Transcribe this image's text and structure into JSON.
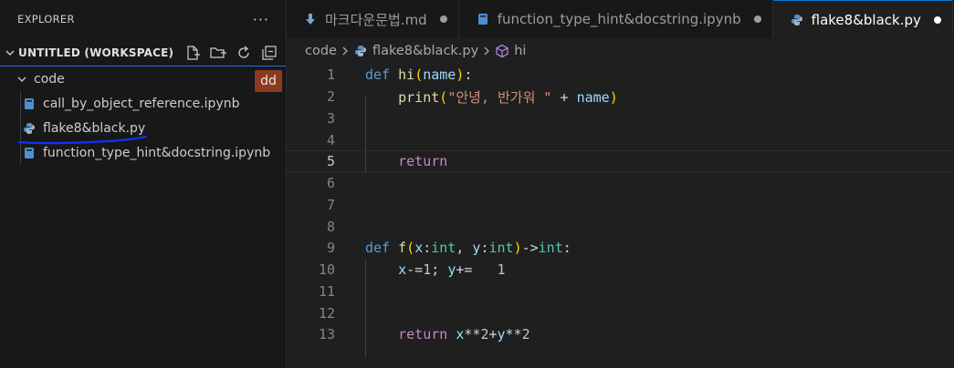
{
  "sidebar": {
    "title": "EXPLORER",
    "more": "···",
    "workspace": "UNTITLED (WORKSPACE)",
    "folder": "code",
    "badge": "dd",
    "files": [
      {
        "name": "call_by_object_reference.ipynb",
        "icon": "notebook-icon"
      },
      {
        "name": "flake8&black.py",
        "icon": "python-icon"
      },
      {
        "name": "function_type_hint&docstring.ipynb",
        "icon": "notebook-icon"
      }
    ]
  },
  "tabs": [
    {
      "label": "마크다운문법.md",
      "icon": "markdown-icon",
      "active": false
    },
    {
      "label": "function_type_hint&docstring.ipynb",
      "icon": "notebook-icon",
      "active": false
    },
    {
      "label": "flake8&black.py",
      "icon": "python-icon",
      "active": true
    }
  ],
  "breadcrumb": {
    "folder": "code",
    "file": "flake8&black.py",
    "symbol": "hi"
  },
  "editor": {
    "current_line": 5,
    "line_numbers": [
      "1",
      "2",
      "3",
      "4",
      "5",
      "6",
      "7",
      "8",
      "9",
      "10",
      "11",
      "12",
      "13"
    ]
  },
  "colors": {
    "accent": "#0078d4",
    "keyword": "#569cd6",
    "function": "#dcdcaa",
    "string": "#ce9178",
    "badge": "#8b3a1f"
  }
}
